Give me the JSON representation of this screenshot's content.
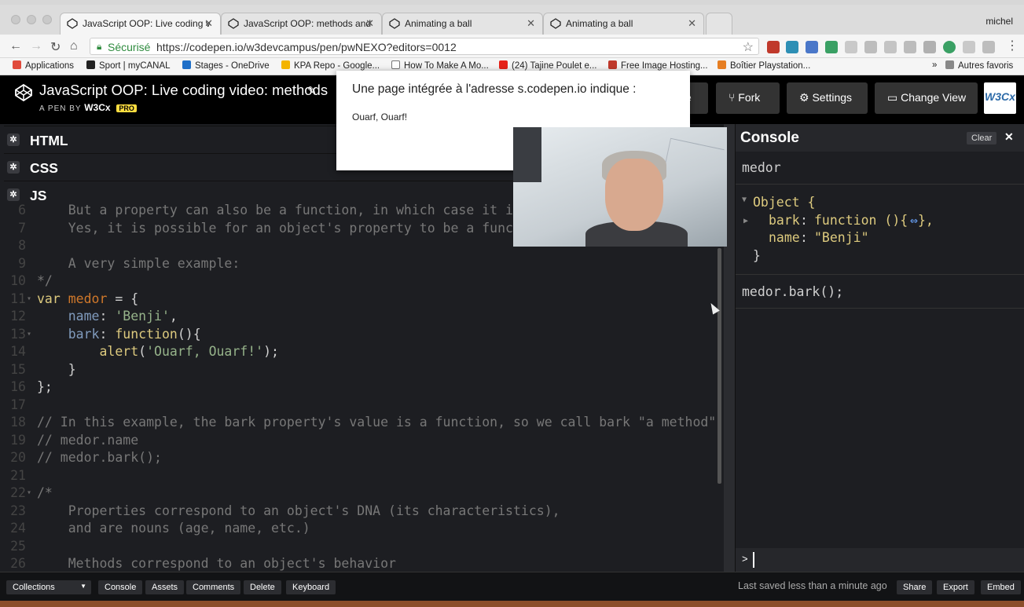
{
  "browser": {
    "tabs": [
      {
        "title": "JavaScript OOP: Live coding v",
        "active": true
      },
      {
        "title": "JavaScript OOP: methods and",
        "active": false
      },
      {
        "title": "Animating a ball",
        "active": false
      },
      {
        "title": "Animating a ball",
        "active": false
      }
    ],
    "profile": "michel",
    "secure_label": "Sécurisé",
    "url": "https://codepen.io/w3devcampus/pen/pwNEXO?editors=0012",
    "bookmarks": [
      "Applications",
      "Sport | myCANAL",
      "Stages - OneDrive",
      "KPA Repo - Google...",
      "How To Make A Mo...",
      "(24) Tajine Poulet e...",
      "Free Image Hosting...",
      "Boîtier Playstation..."
    ],
    "bookmarks_overflow": "»",
    "other_bookmarks": "Autres favoris"
  },
  "codepen": {
    "pen_title": "JavaScript OOP: Live coding video: methods",
    "byline_prefix": "A PEN BY",
    "author": "W3Cx",
    "pro_badge": "PRO",
    "buttons": {
      "save_partial": "e",
      "fork": "Fork",
      "settings": "Settings",
      "change_view": "Change View"
    },
    "avatar_text": "W3Cx"
  },
  "editors": {
    "html_label": "HTML",
    "css_label": "CSS",
    "js_label": "JS"
  },
  "code_lines": [
    {
      "n": "6",
      "fold": false,
      "parts": [
        [
          "cm",
          "    But a property can also be a function, in which case it is"
        ]
      ]
    },
    {
      "n": "7",
      "fold": false,
      "parts": [
        [
          "cm",
          "    Yes, it is possible for an object's property to be a funct"
        ]
      ]
    },
    {
      "n": "8",
      "fold": false,
      "parts": []
    },
    {
      "n": "9",
      "fold": false,
      "parts": [
        [
          "cm",
          "    A very simple example:"
        ]
      ]
    },
    {
      "n": "10",
      "fold": false,
      "parts": [
        [
          "cm",
          "*/"
        ]
      ]
    },
    {
      "n": "11",
      "fold": true,
      "parts": [
        [
          "kw",
          "var "
        ],
        [
          "vn",
          "medor"
        ],
        [
          "op",
          " = {"
        ]
      ]
    },
    {
      "n": "12",
      "fold": false,
      "parts": [
        [
          "op",
          "    "
        ],
        [
          "pr",
          "name"
        ],
        [
          "op",
          ": "
        ],
        [
          "st",
          "'Benji'"
        ],
        [
          "op",
          ","
        ]
      ]
    },
    {
      "n": "13",
      "fold": true,
      "parts": [
        [
          "op",
          "    "
        ],
        [
          "pr",
          "bark"
        ],
        [
          "op",
          ": "
        ],
        [
          "fn",
          "function"
        ],
        [
          "op",
          "(){"
        ]
      ]
    },
    {
      "n": "14",
      "fold": false,
      "parts": [
        [
          "op",
          "        "
        ],
        [
          "fn",
          "alert"
        ],
        [
          "op",
          "("
        ],
        [
          "st",
          "'Ouarf, Ouarf!'"
        ],
        [
          "op",
          ");"
        ]
      ]
    },
    {
      "n": "15",
      "fold": false,
      "parts": [
        [
          "op",
          "    }"
        ]
      ]
    },
    {
      "n": "16",
      "fold": false,
      "parts": [
        [
          "op",
          "};"
        ]
      ]
    },
    {
      "n": "17",
      "fold": false,
      "parts": []
    },
    {
      "n": "18",
      "fold": false,
      "parts": [
        [
          "cm",
          "// In this example, the bark property's value is a function, so we call bark \"a method\"."
        ]
      ]
    },
    {
      "n": "19",
      "fold": false,
      "parts": [
        [
          "cm",
          "// medor.name"
        ]
      ]
    },
    {
      "n": "20",
      "fold": false,
      "parts": [
        [
          "cm",
          "// medor.bark();"
        ]
      ]
    },
    {
      "n": "21",
      "fold": false,
      "parts": []
    },
    {
      "n": "22",
      "fold": true,
      "parts": [
        [
          "cm",
          "/*"
        ]
      ]
    },
    {
      "n": "23",
      "fold": false,
      "parts": [
        [
          "cm",
          "    Properties correspond to an object's DNA (its characteristics),"
        ]
      ]
    },
    {
      "n": "24",
      "fold": false,
      "parts": [
        [
          "cm",
          "    and are nouns (age, name, etc.)"
        ]
      ]
    },
    {
      "n": "25",
      "fold": false,
      "parts": []
    },
    {
      "n": "26",
      "fold": false,
      "parts": [
        [
          "cm",
          "    Methods correspond to an object's behavior"
        ]
      ]
    }
  ],
  "console": {
    "title": "Console",
    "clear_label": "Clear",
    "close_glyph": "✕",
    "entry1_input": "medor",
    "object_label": "Object {",
    "prop_bark_key": "bark",
    "prop_bark_val": "function (){",
    "prop_bark_ellipsis": "⇔",
    "prop_bark_end": "},",
    "prop_name_key": "name",
    "prop_name_val": "\"Benji\"",
    "object_close": "}",
    "entry2_input": "medor.bark();",
    "prompt_caret": ">"
  },
  "footer": {
    "collections": "Collections",
    "console": "Console",
    "assets": "Assets",
    "comments": "Comments",
    "delete": "Delete",
    "keyboard": "Keyboard",
    "saved_status": "Last saved less than a minute ago",
    "share": "Share",
    "export": "Export",
    "embed": "Embed"
  },
  "alert": {
    "title": "Une page intégrée à l'adresse s.codepen.io indique :",
    "message": "Ouarf, Ouarf!"
  },
  "colors": {
    "editor_bg": "#1d1e22",
    "keyword": "#ddca7e",
    "variable": "#d0782a",
    "property": "#809bbd",
    "string": "#96b38a",
    "comment": "#777777",
    "pro_badge": "#ffdd40"
  }
}
